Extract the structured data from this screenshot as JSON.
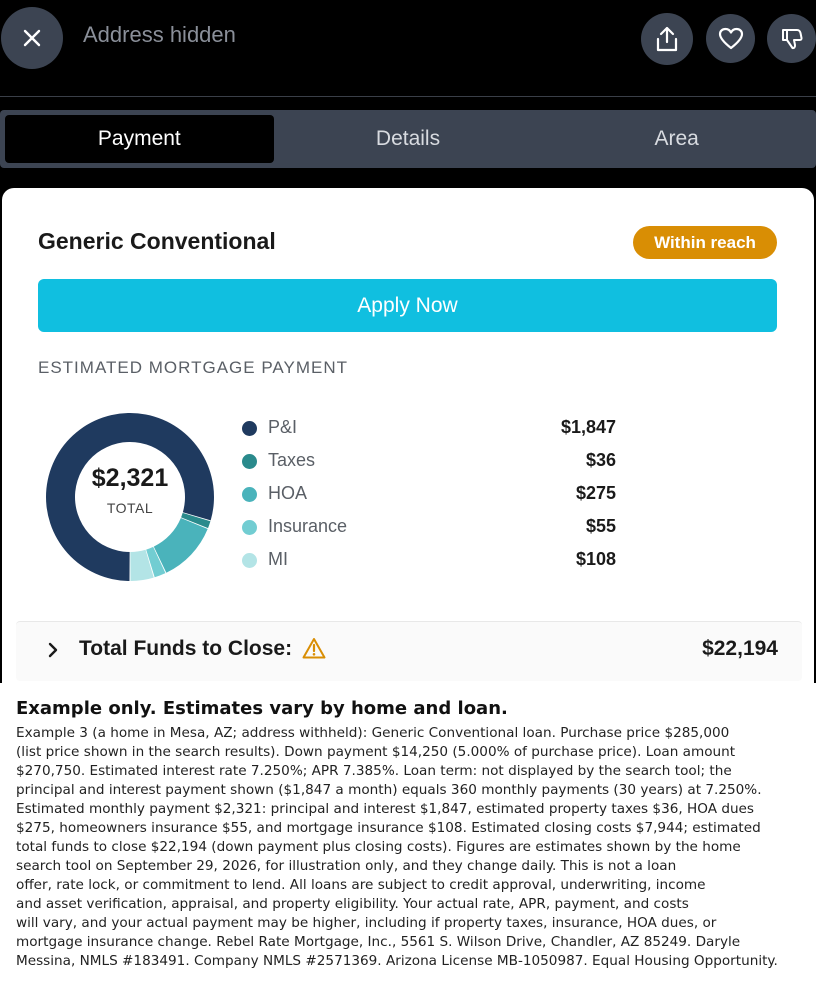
{
  "header": {
    "address": "Address hidden"
  },
  "tabs": [
    {
      "label": "Payment"
    },
    {
      "label": "Details"
    },
    {
      "label": "Area"
    }
  ],
  "loan": {
    "title": "Generic Conventional",
    "badge": "Within reach",
    "apply_label": "Apply Now"
  },
  "payment": {
    "section_label": "ESTIMATED MORTGAGE PAYMENT",
    "total": "$2,321",
    "total_label": "TOTAL",
    "breakdown": [
      {
        "label": "P&I",
        "value": "$1,847",
        "amount": 1847,
        "color": "#1f3a5f"
      },
      {
        "label": "Taxes",
        "value": "$36",
        "amount": 36,
        "color": "#2a8a8c"
      },
      {
        "label": "HOA",
        "value": "$275",
        "amount": 275,
        "color": "#4ab3bb"
      },
      {
        "label": "Insurance",
        "value": "$55",
        "amount": 55,
        "color": "#72cdd2"
      },
      {
        "label": "MI",
        "value": "$108",
        "amount": 108,
        "color": "#b3e4e6"
      }
    ]
  },
  "closing": {
    "label": "Total Funds to Close:",
    "value": "$22,194"
  },
  "icons": {
    "close": "close-icon",
    "share": "share-icon",
    "favorite": "heart-icon",
    "dislike": "thumbs-down-icon",
    "expand": "chevron-right-icon",
    "warning": "warning-icon"
  },
  "disclaimer": {
    "heading": "Example only. Estimates vary by home and loan.",
    "lines": [
      "Example 3 (a home in Mesa, AZ; address withheld): Generic Conventional loan. Purchase price $285,000",
      "(list price shown in the search results). Down payment $14,250 (5.000% of purchase price). Loan amount",
      "$270,750. Estimated interest rate 7.250%; APR 7.385%. Loan term: not displayed by the search tool; the",
      "principal and interest payment shown ($1,847 a month) equals 360 monthly payments (30 years) at 7.250%.",
      "Estimated monthly payment $2,321: principal and interest $1,847, estimated property taxes $36, HOA dues",
      "$275, homeowners insurance $55, and mortgage insurance $108. Estimated closing costs $7,944; estimated",
      "total funds to close $22,194 (down payment plus closing costs). Figures are estimates shown by the home",
      "search tool on September 29, 2026, for illustration only, and they change daily. This is not a loan",
      "offer, rate lock, or commitment to lend. All loans are subject to credit approval, underwriting, income",
      "and asset verification, appraisal, and property eligibility. Your actual rate, APR, payment, and costs",
      "will vary, and your actual payment may be higher, including if property taxes, insurance, HOA dues, or",
      "mortgage insurance change. Rebel Rate Mortgage, Inc., 5561 S. Wilson Drive, Chandler, AZ 85249. Daryle",
      "Messina, NMLS #183491. Company NMLS #2571369. Arizona License MB-1050987. Equal Housing Opportunity."
    ]
  }
}
